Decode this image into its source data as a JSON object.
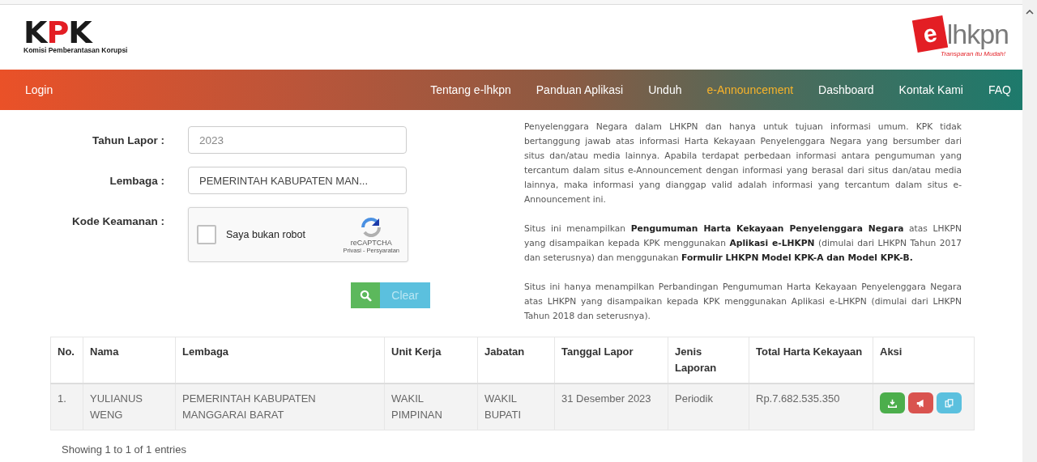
{
  "header": {
    "kpk_logo": {
      "letters": [
        {
          "text": "K",
          "color": "#1a1a1a"
        },
        {
          "text": "P",
          "color": "#e31e24"
        },
        {
          "text": "K",
          "color": "#1a1a1a"
        }
      ],
      "subtitle": "Komisi Pemberantasan Korupsi"
    },
    "elhkpn_logo": {
      "badge": "e",
      "word": "lhkpn",
      "tagline": "Transparan itu Mudah!"
    }
  },
  "nav": {
    "login": "Login",
    "items": [
      {
        "label": "Tentang e-lhkpn",
        "selected": false
      },
      {
        "label": "Panduan Aplikasi",
        "selected": false
      },
      {
        "label": "Unduh",
        "selected": false
      },
      {
        "label": "e-Announcement",
        "selected": true
      },
      {
        "label": "Dashboard",
        "selected": false
      },
      {
        "label": "Kontak Kami",
        "selected": false
      },
      {
        "label": "FAQ",
        "selected": false
      }
    ]
  },
  "form": {
    "tahun": {
      "label": "Tahun Lapor :",
      "value": "2023"
    },
    "lembaga": {
      "label": "Lembaga :",
      "value": "PEMERINTAH KABUPATEN MAN..."
    },
    "captcha": {
      "label": "Kode Keamanan :",
      "checkbox_label": "Saya bukan robot",
      "checked": false,
      "brand": "reCAPTCHA",
      "links": "Privasi - Persyaratan"
    },
    "clear_button": "Clear"
  },
  "paragraphs": [
    "Penyelenggara Negara dalam LHKPN dan hanya untuk tujuan informasi umum. KPK tidak bertanggung jawab atas informasi Harta Kekayaan Penyelenggara Negara yang bersumber dari situs dan/atau media lainnya. Apabila terdapat perbedaan informasi antara pengumuman yang tercantum dalam situs e-Announcement dengan informasi yang berasal dari situs dan/atau media lainnya, maka informasi yang dianggap valid adalah informasi yang tercantum dalam situs e-Announcement ini.",
    "Situs ini menampilkan **Pengumuman Harta Kekayaan Penyelenggara Negara** atas LHKPN yang disampaikan kepada KPK menggunakan **Aplikasi e-LHKPN** (dimulai dari LHKPN Tahun 2017 dan seterusnya) dan menggunakan **Formulir LHKPN Model KPK-A dan Model KPK-B.**",
    "Situs ini hanya menampilkan Perbandingan Pengumuman Harta Kekayaan Penyelenggara Negara atas LHKPN yang disampaikan kepada KPK menggunakan Aplikasi e-LHKPN (dimulai dari LHKPN Tahun 2018 dan seterusnya)."
  ],
  "table": {
    "columns": [
      "No.",
      "Nama",
      "Lembaga",
      "Unit Kerja",
      "Jabatan",
      "Tanggal Lapor",
      "Jenis Laporan",
      "Total Harta Kekayaan",
      "Aksi"
    ],
    "rows": [
      {
        "cells": [
          "1.",
          "YULIANUS WENG",
          "PEMERINTAH KABUPATEN MANGGARAI BARAT",
          "WAKIL PIMPINAN",
          "WAKIL BUPATI",
          "31 Desember 2023",
          "Periodik",
          "Rp.7.682.535.350"
        ],
        "actions": [
          {
            "kind": "download",
            "color": "#4cae4c"
          },
          {
            "kind": "announce",
            "color": "#d9534f"
          },
          {
            "kind": "copy",
            "color": "#5bc0de"
          }
        ]
      }
    ]
  },
  "footer_info": "Showing 1 to 1 of 1 entries"
}
